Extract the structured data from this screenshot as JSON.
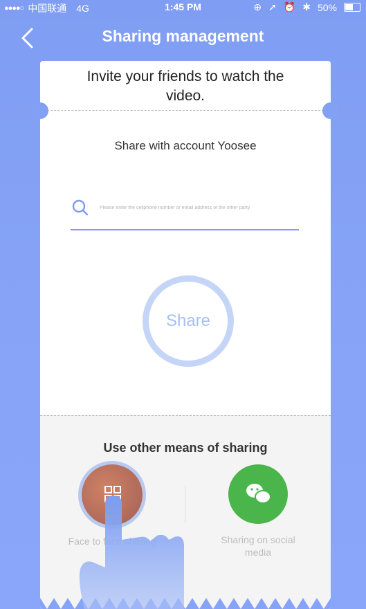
{
  "status": {
    "carrier": "中国联通",
    "network": "4G",
    "time": "1:45 PM",
    "battery": "50%",
    "battery_level": 0.5
  },
  "nav": {
    "title": "Sharing management",
    "back_icon": "chevron-left-icon"
  },
  "card": {
    "invite_text": "Invite your friends to watch the video.",
    "share_account_text": "Share with account Yoosee",
    "search_placeholder": "Please enter the cellphone number or email address of the other party.",
    "search_value": "",
    "share_button": "Share"
  },
  "other": {
    "title": "Use other means of sharing",
    "options": [
      {
        "label": "Face to face sharing",
        "icon": "qr-code-icon",
        "color": "#a8615a"
      },
      {
        "label": "Sharing on social media",
        "icon": "wechat-icon",
        "color": "#49b54a"
      }
    ]
  },
  "colors": {
    "background": "#86a3f7",
    "accent": "#7b9cf0",
    "share_ring": "#c5d5f8"
  }
}
